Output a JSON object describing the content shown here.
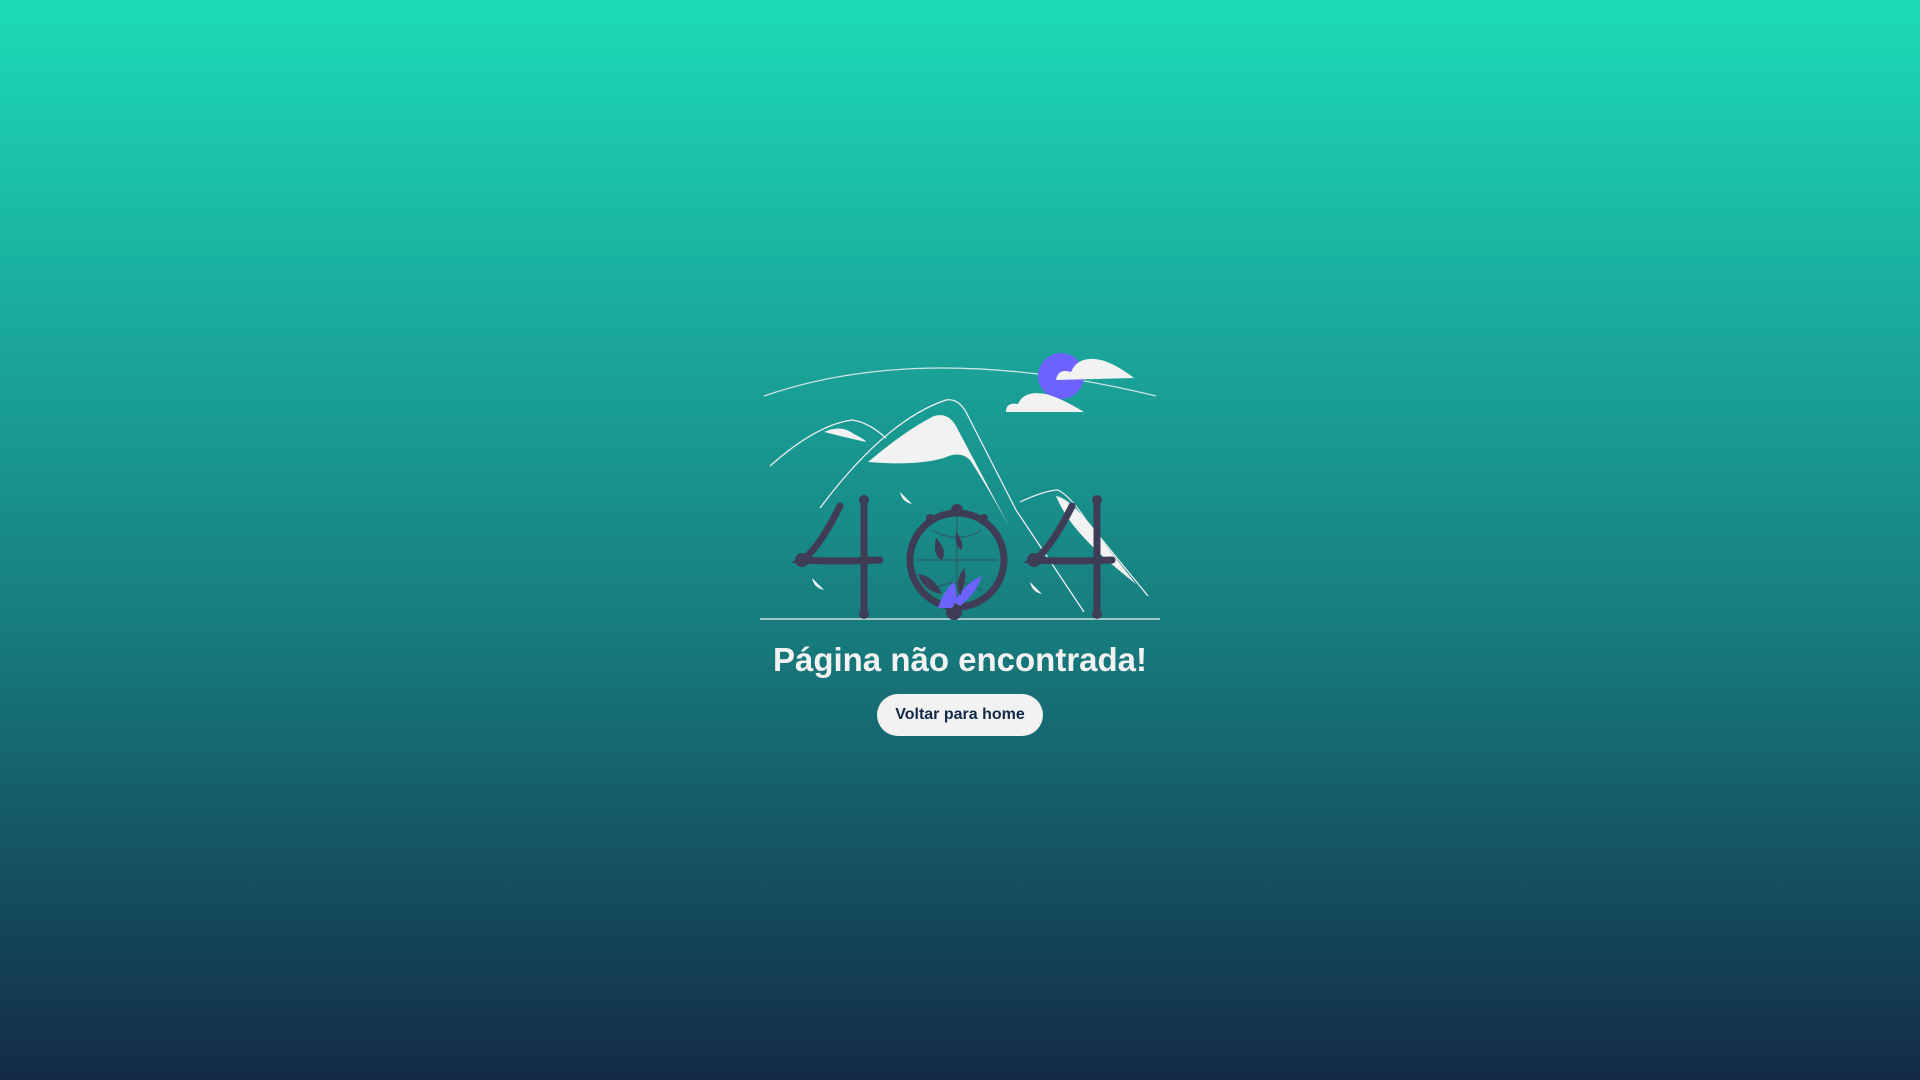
{
  "page": {
    "title": "Página não encontrada!",
    "home_button_label": "Voltar para home"
  },
  "illustration": {
    "icon": "404-mountains-illustration",
    "colors": {
      "digits": "#3f3d56",
      "accent": "#6c63ff",
      "snow": "#f2f2f2",
      "lines": "#f2f2f2"
    }
  },
  "colors": {
    "gradient_top": "#1ddbb6",
    "gradient_bottom": "#132a48",
    "button_bg": "#f2f2f2",
    "button_text": "#132a48",
    "title_text": "#f2f2f2"
  }
}
